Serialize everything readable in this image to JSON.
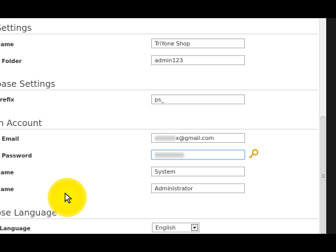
{
  "sections": [
    {
      "title": "Settings",
      "fields": [
        {
          "label": "Name",
          "value": "TriYone Shop"
        },
        {
          "label": "n Folder",
          "value": "admin123"
        }
      ]
    },
    {
      "title": "base Settings",
      "fields": [
        {
          "label": "Prefix",
          "value": "ps_"
        }
      ]
    },
    {
      "title": "in Account",
      "fields": [
        {
          "label": "n Email",
          "value": "x@gmail.com"
        },
        {
          "label": "n Password",
          "value": ""
        },
        {
          "label": "Name",
          "value": "System"
        },
        {
          "label": "Name",
          "value": "Administrator"
        }
      ]
    },
    {
      "title": "ose Language",
      "fields": [
        {
          "label": "l Language",
          "value": "English"
        }
      ]
    }
  ],
  "icons": {
    "password_generator": "key-icon",
    "cursor": "mouse-pointer-icon"
  },
  "colors": {
    "cursor_highlight": "#ffe600",
    "focus_border": "#8fb8e0"
  }
}
